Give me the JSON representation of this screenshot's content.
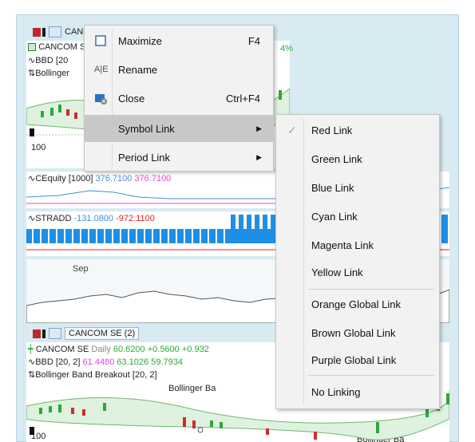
{
  "chart1": {
    "tab_title": "CANCOM SE (2)",
    "tab_title_partial": "CANCO",
    "line_symbol": "CANCOM SE",
    "line_bbd": "BBD",
    "line_bbd_params": "[20, 2]",
    "line_bbd_partial": "[20",
    "line_bollinger": "Bollinger",
    "price_100": "100",
    "percent_partial": "4%"
  },
  "equity": {
    "name": "CEquity",
    "param": "[1000]",
    "v1": "376.7100",
    "v2": "376.7100"
  },
  "stradd": {
    "name": "STRADD",
    "v1": "-131.0800",
    "v2": "-972.1100"
  },
  "overview": {
    "month": "Sep"
  },
  "chart2": {
    "tab_title": "CANCOM SE (2)",
    "symbol": "CANCOM SE",
    "period": "Daily",
    "price": "60.6200",
    "change": "+0.5600",
    "change_pct_partial": "+0.932",
    "bbd": "BBD",
    "bbd_params": "[20, 2]",
    "bbd_v1": "61.4480",
    "bbd_v2": "63.1026",
    "bbd_v3": "59.7934",
    "breakout": "Bollinger Band Breakout",
    "breakout_params": "[20, 2]",
    "marker1": "Bollinger Ba",
    "marker2": "Bollinger Ba",
    "price_100": "100"
  },
  "context_menu": {
    "items": [
      {
        "label": "Maximize",
        "shortcut": "F4",
        "icon": "maximize-icon"
      },
      {
        "label": "Rename",
        "shortcut": "",
        "icon": "rename-icon"
      },
      {
        "label": "Close",
        "shortcut": "Ctrl+F4",
        "icon": "close-window-icon"
      },
      {
        "label": "Symbol Link",
        "shortcut": "",
        "icon": ""
      },
      {
        "label": "Period Link",
        "shortcut": "",
        "icon": ""
      }
    ]
  },
  "submenu": {
    "items": [
      {
        "label": "Red Link",
        "checked": true
      },
      {
        "label": "Green Link"
      },
      {
        "label": "Blue Link"
      },
      {
        "label": "Cyan Link"
      },
      {
        "label": "Magenta Link"
      },
      {
        "label": "Yellow Link"
      },
      {
        "label": "Orange Global Link"
      },
      {
        "label": "Brown Global Link"
      },
      {
        "label": "Purple Global Link"
      },
      {
        "label": "No Linking"
      }
    ]
  },
  "colors": {
    "accent_blue": "#1e8fe6",
    "equity_blue": "#3d8fe0",
    "equity_magenta": "#e04ad6",
    "stradd_red": "#e02020",
    "up_green": "#2da83a",
    "down_red": "#d42a2a",
    "band_fill": "#dff2df"
  }
}
